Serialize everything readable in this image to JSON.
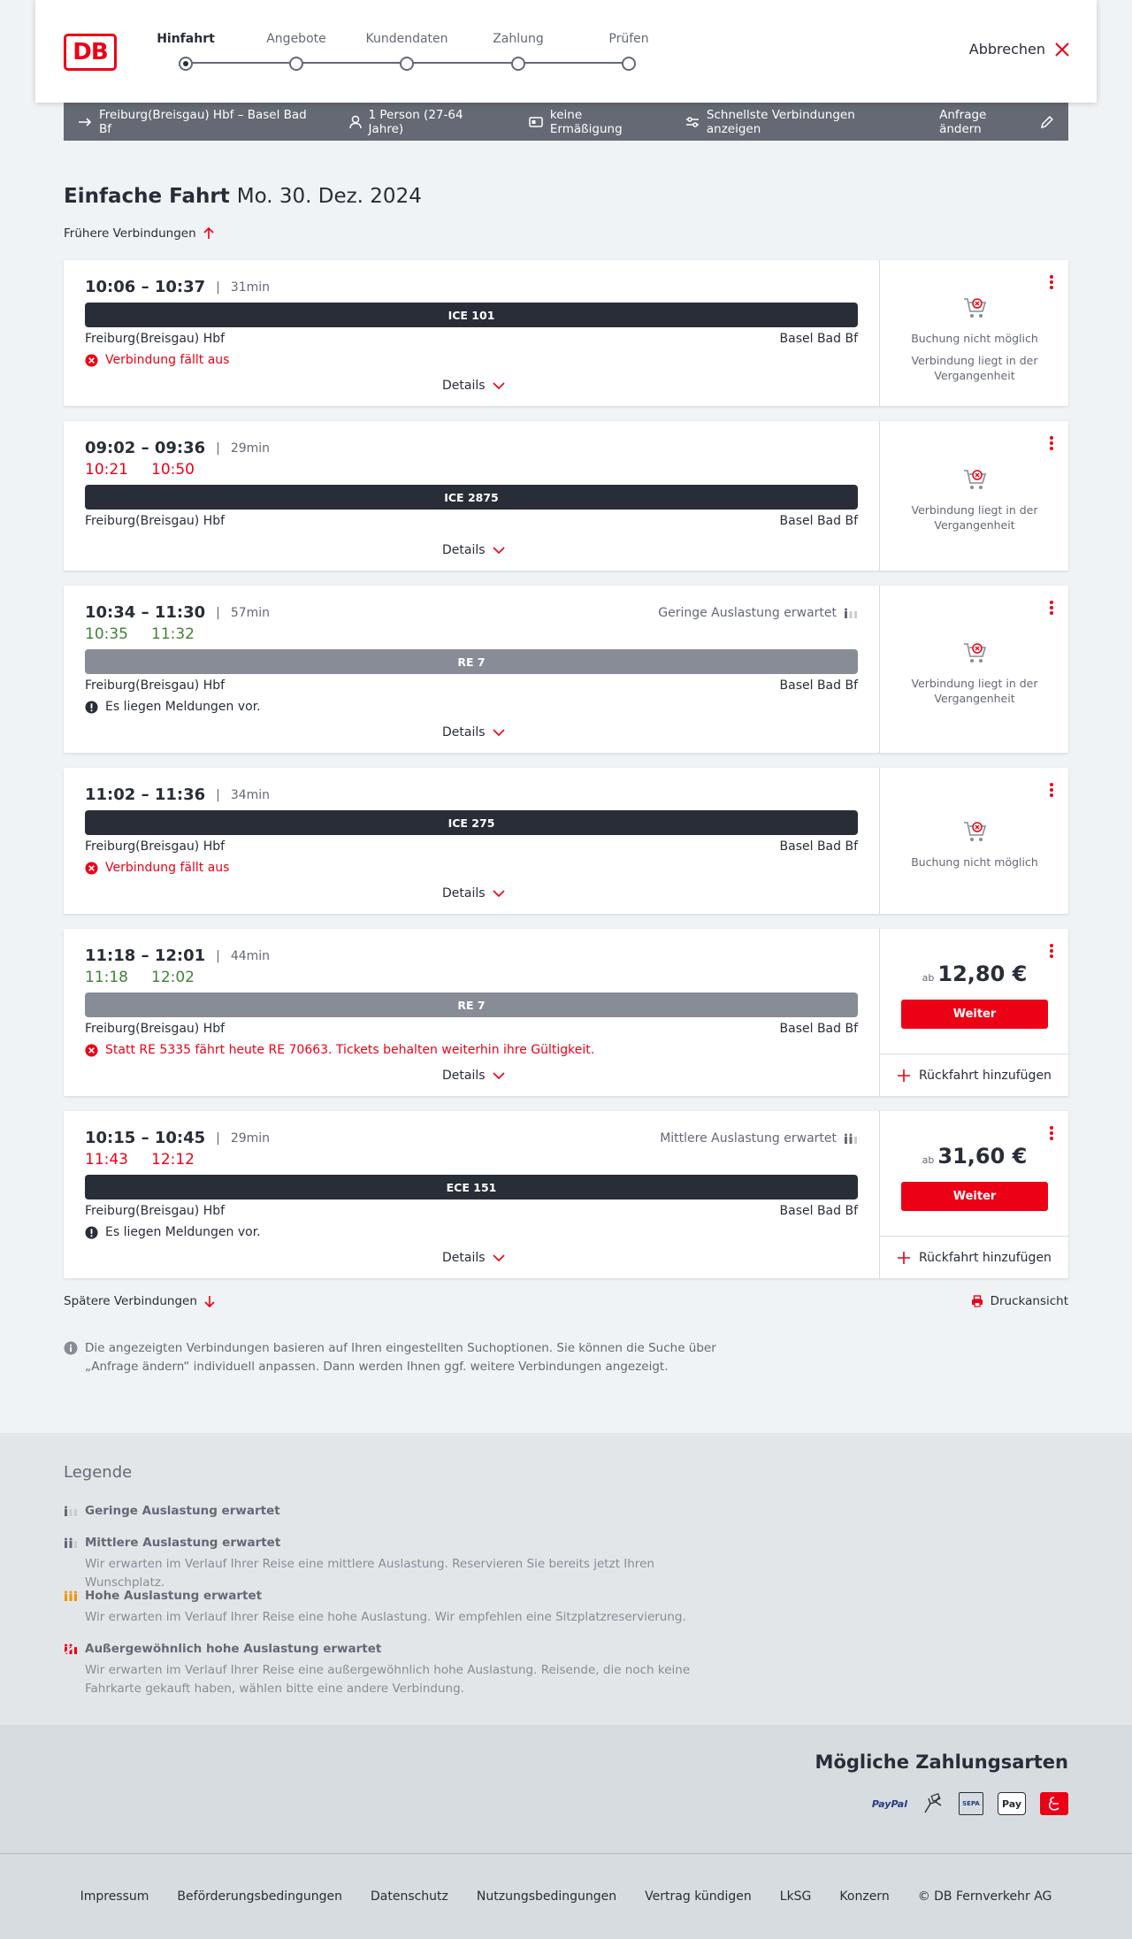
{
  "header": {
    "logo": "DB",
    "steps": [
      "Hinfahrt",
      "Angebote",
      "Kundendaten",
      "Zahlung",
      "Prüfen"
    ],
    "active_step": "Hinfahrt",
    "cancel_label": "Abbrechen"
  },
  "query": {
    "route": "Freiburg(Breisgau) Hbf – Basel Bad Bf",
    "passengers": "1 Person (27-64 Jahre)",
    "discount": "keine Ermäßigung",
    "fastest": "Schnellste Verbindungen anzeigen",
    "edit": "Anfrage ändern"
  },
  "main": {
    "title_bold": "Einfache Fahrt",
    "title_date": "Mo. 30. Dez. 2024",
    "earlier": "Frühere Verbindungen",
    "later": "Spätere Verbindungen",
    "print": "Druckansicht",
    "info": "Die angezeigten Verbindungen basieren auf Ihren eingestellten Suchoptionen. Sie können die Suche über „Anfrage ändern“ individuell anpassen. Dann werden Ihnen ggf. weitere Verbindungen angezeigt.",
    "details_label": "Details",
    "return_label": "Rückfahrt hinzufügen",
    "weiter_label": "Weiter",
    "price_prefix": "ab"
  },
  "connections": [
    {
      "times": "10:06 – 10:37",
      "duration": "31min",
      "train": "ICE 101",
      "from": "Freiburg(Breisgau) Hbf",
      "to": "Basel Bad Bf",
      "message": "Verbindung fällt aus",
      "right_line1": "Buchung nicht möglich",
      "right_line2": "Verbindung liegt in der Vergangenheit"
    },
    {
      "times": "09:02 – 09:36",
      "duration": "29min",
      "rt_dep": "10:21",
      "rt_arr": "10:50",
      "train": "ICE 2875",
      "from": "Freiburg(Breisgau) Hbf",
      "to": "Basel Bad Bf",
      "right_line2": "Verbindung liegt in der Vergangenheit"
    },
    {
      "times": "10:34 – 11:30",
      "duration": "57min",
      "rt_dep": "10:35",
      "rt_arr": "11:32",
      "load": "Geringe Auslastung erwartet",
      "train": "RE 7",
      "from": "Freiburg(Breisgau) Hbf",
      "to": "Basel Bad Bf",
      "message": "Es liegen Meldungen vor.",
      "right_line2": "Verbindung liegt in der Vergangenheit"
    },
    {
      "times": "11:02 – 11:36",
      "duration": "34min",
      "train": "ICE 275",
      "from": "Freiburg(Breisgau) Hbf",
      "to": "Basel Bad Bf",
      "message": "Verbindung fällt aus",
      "right_line1": "Buchung nicht möglich"
    },
    {
      "times": "11:18 – 12:01",
      "duration": "44min",
      "rt_dep": "11:18",
      "rt_arr": "12:02",
      "train": "RE 7",
      "from": "Freiburg(Breisgau) Hbf",
      "to": "Basel Bad Bf",
      "message": "Statt RE 5335 fährt heute RE 70663. Tickets behalten weiterhin ihre Gültigkeit.",
      "price": "12,80 €"
    },
    {
      "times": "10:15 – 10:45",
      "duration": "29min",
      "rt_dep": "11:43",
      "rt_arr": "12:12",
      "load": "Mittlere Auslastung erwartet",
      "train": "ECE 151",
      "from": "Freiburg(Breisgau) Hbf",
      "to": "Basel Bad Bf",
      "message": "Es liegen Meldungen vor.",
      "price": "31,60 €"
    }
  ],
  "legend": {
    "title": "Legende",
    "items": [
      {
        "title": "Geringe Auslastung erwartet"
      },
      {
        "title": "Mittlere Auslastung erwartet",
        "desc": "Wir erwarten im Verlauf Ihrer Reise eine mittlere Auslastung. Reservieren Sie bereits jetzt Ihren Wunschplatz."
      },
      {
        "title": "Hohe Auslastung erwartet",
        "desc": "Wir erwarten im Verlauf Ihrer Reise eine hohe Auslastung. Wir empfehlen eine Sitzplatzreservierung."
      },
      {
        "title": "Außergewöhnlich hohe Auslastung erwartet",
        "desc": "Wir erwarten im Verlauf Ihrer Reise eine außergewöhnlich hohe Auslastung. Reisende, die noch keine Fahrkarte gekauft haben, wählen bitte eine andere Verbindung."
      }
    ]
  },
  "payment": {
    "title": "Mögliche Zahlungsarten",
    "paypal": "PayPal",
    "sepa": "SEPA",
    "applepay": "Pay"
  },
  "footer": {
    "links": [
      "Impressum",
      "Beförderungsbedingungen",
      "Datenschutz",
      "Nutzungsbedingungen",
      "Vertrag kündigen",
      "LkSG",
      "Konzern",
      "© DB Fernverkehr AG"
    ]
  },
  "colors": {
    "accent": "#ec0016",
    "dark": "#282d37",
    "bar": "#646973",
    "delay": "#ec0016",
    "ontime": "#408335"
  }
}
